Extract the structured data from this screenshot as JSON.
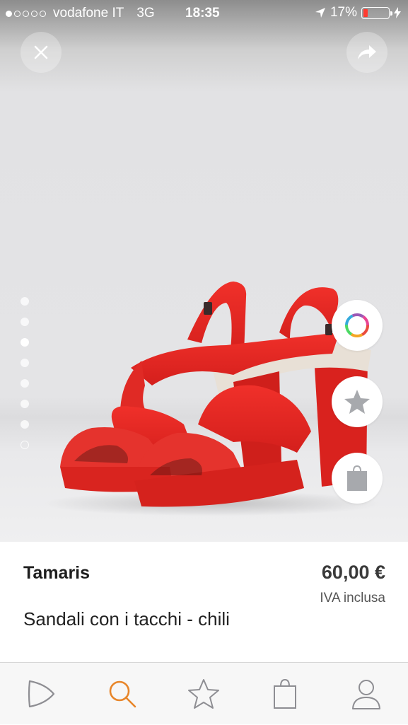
{
  "status_bar": {
    "carrier": "vodafone IT",
    "network": "3G",
    "time": "18:35",
    "battery_percent": "17%",
    "battery_level": 0.17,
    "signal_bars_filled": 1,
    "signal_bars_total": 5,
    "battery_color": "#ff3b30"
  },
  "header": {
    "close_icon": "close-icon",
    "share_icon": "share-icon"
  },
  "gallery": {
    "image_subject": "red-heeled-sandals",
    "page_count": 8,
    "active_page": 3,
    "last_item_type": "video"
  },
  "side_actions": [
    {
      "icon": "color-ring-icon"
    },
    {
      "icon": "star-icon"
    },
    {
      "icon": "shopping-bag-icon"
    }
  ],
  "product": {
    "brand": "Tamaris",
    "price": "60,00 €",
    "vat_note": "IVA inclusa",
    "name": "Sandali con i tacchi - chili"
  },
  "tab_bar": {
    "active_tab": "search",
    "accent_color": "#e8862a",
    "tabs": [
      {
        "id": "home",
        "icon": "zalando-logo-icon"
      },
      {
        "id": "search",
        "icon": "search-icon"
      },
      {
        "id": "wishlist",
        "icon": "star-icon"
      },
      {
        "id": "cart",
        "icon": "shopping-bag-icon"
      },
      {
        "id": "account",
        "icon": "user-icon"
      }
    ]
  }
}
